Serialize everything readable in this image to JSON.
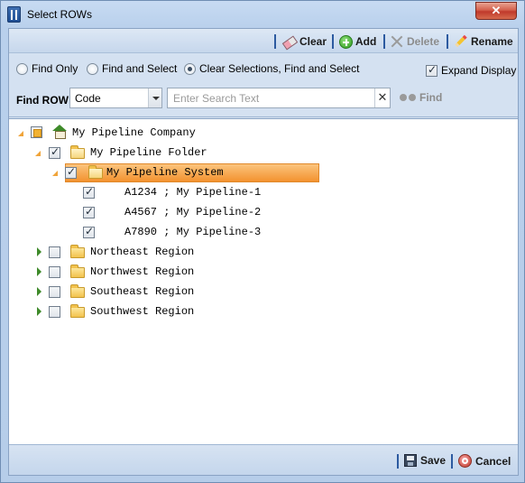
{
  "window": {
    "title": "Select ROWs",
    "close_glyph": "✕",
    "title_icon": "pipeline-app-icon"
  },
  "toolbar": {
    "clear_label": "Clear",
    "add_label": "Add",
    "delete_label": "Delete",
    "rename_label": "Rename",
    "icons": [
      "eraser-icon",
      "add-icon",
      "delete-icon",
      "pencil-icon"
    ]
  },
  "options": {
    "radio_find_only": "Find Only",
    "radio_find_select": "Find and Select",
    "radio_clear_find_select": "Clear Selections, Find and Select",
    "selected_radio": "Clear Selections, Find and Select",
    "expand_display_label": "Expand Display",
    "expand_display_checked": true
  },
  "find": {
    "label": "Find ROW",
    "field_value": "Code",
    "search_placeholder": "Enter Search Text",
    "search_value": "",
    "clear_glyph": "✕",
    "find_label": "Find"
  },
  "tree": {
    "root": "My Pipeline Company",
    "folder": "My Pipeline Folder",
    "system": "My Pipeline System",
    "pipelines": [
      "A1234 ; My Pipeline-1",
      "A4567 ; My Pipeline-2",
      "A7890 ; My Pipeline-3"
    ],
    "regions": [
      "Northeast Region",
      "Northwest Region",
      "Southeast Region",
      "Southwest Region"
    ]
  },
  "footer": {
    "save_label": "Save",
    "cancel_label": "Cancel"
  },
  "colors": {
    "selection": "#f3922f",
    "accent": "#2c5aa0"
  }
}
